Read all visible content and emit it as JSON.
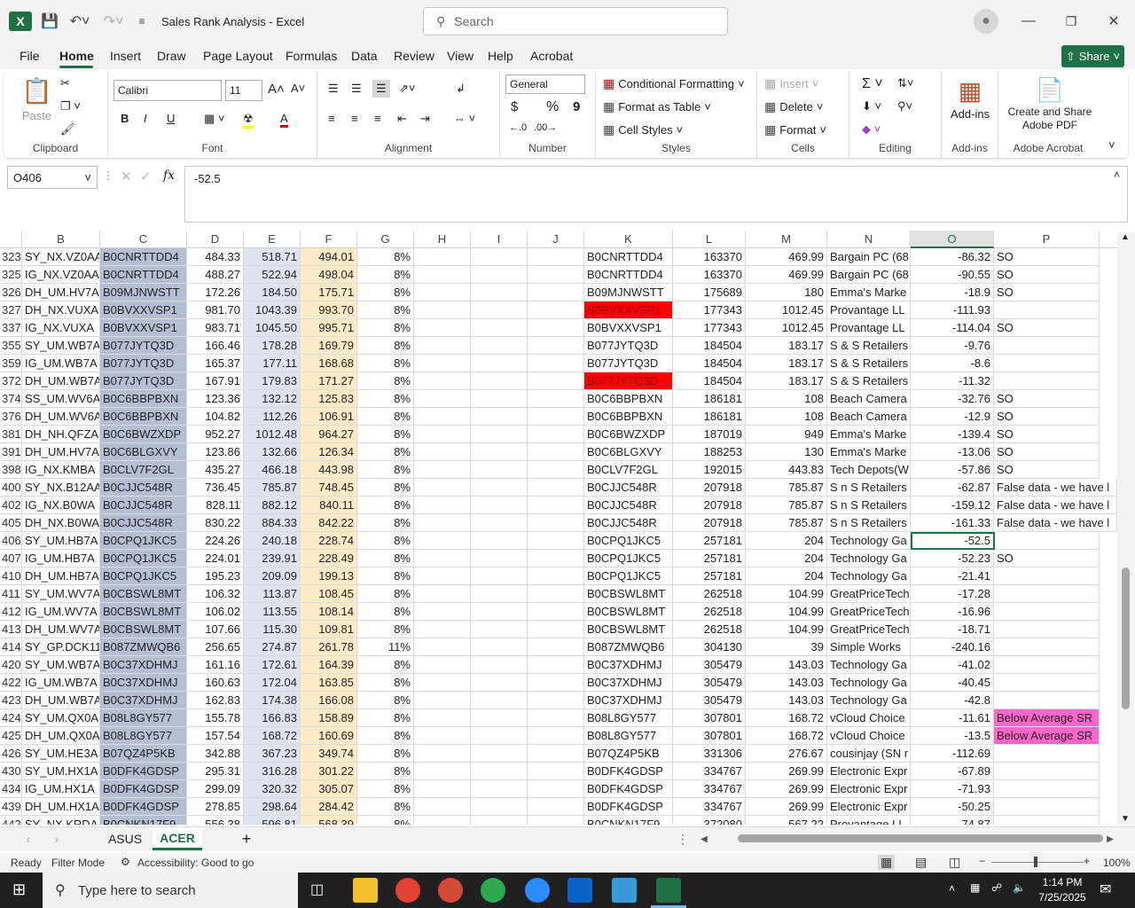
{
  "window": {
    "title": "Sales Rank Analysis  -  Excel",
    "search_placeholder": "Search",
    "share_label": "Share"
  },
  "menu": [
    "File",
    "Home",
    "Insert",
    "Draw",
    "Page Layout",
    "Formulas",
    "Data",
    "Review",
    "View",
    "Help",
    "Acrobat"
  ],
  "ribbon": {
    "clipboard": {
      "paste": "Paste",
      "label": "Clipboard"
    },
    "font": {
      "name": "Calibri",
      "size": "11",
      "label": "Font",
      "bold": "B",
      "italic": "I",
      "underline": "U"
    },
    "alignment": {
      "label": "Alignment"
    },
    "number": {
      "format": "General",
      "label": "Number",
      "dollar": "$",
      "percent": "%",
      "comma": "9"
    },
    "styles": {
      "cond": "Conditional Formatting",
      "table": "Format as Table",
      "cell": "Cell Styles",
      "label": "Styles"
    },
    "cells": {
      "insert": "Insert",
      "delete": "Delete",
      "format": "Format",
      "label": "Cells"
    },
    "editing": {
      "label": "Editing"
    },
    "addins": {
      "btn": "Add-ins",
      "label": "Add-ins"
    },
    "acrobat": {
      "btn": "Create and Share Adobe PDF",
      "label": "Adobe Acrobat"
    }
  },
  "formula": {
    "cell": "O406",
    "value": "-52.5",
    "fx": "fx"
  },
  "columns": [
    "B",
    "C",
    "D",
    "E",
    "F",
    "G",
    "H",
    "I",
    "J",
    "K",
    "L",
    "M",
    "N",
    "O",
    "P"
  ],
  "rows": [
    [
      "323",
      "SY_NX.VZ0AA",
      "B0CNRTTDD4",
      "484.33",
      "518.71",
      "494.01",
      "8%",
      "B0CNRTTDD4",
      "163370",
      "469.99",
      "Bargain PC (68",
      "-86.32",
      "SO"
    ],
    [
      "325",
      "IG_NX.VZ0AA",
      "B0CNRTTDD4",
      "488.27",
      "522.94",
      "498.04",
      "8%",
      "B0CNRTTDD4",
      "163370",
      "469.99",
      "Bargain PC (68",
      "-90.55",
      "SO"
    ],
    [
      "326",
      "DH_UM.HV7A",
      "B09MJNWSTT",
      "172.26",
      "184.50",
      "175.71",
      "8%",
      "B09MJNWSTT",
      "175689",
      "180",
      "Emma's Marke",
      "-18.9",
      "SO"
    ],
    [
      "327",
      "DH_NX.VUXA",
      "B0BVXXVSP1",
      "981.70",
      "1043.39",
      "993.70",
      "8%",
      "B0BVXXVSP1",
      "177343",
      "1012.45",
      "Provantage LL",
      "-111.93",
      ""
    ],
    [
      "337",
      "IG_NX.VUXA",
      "B0BVXXVSP1",
      "983.71",
      "1045.50",
      "995.71",
      "8%",
      "B0BVXXVSP1",
      "177343",
      "1012.45",
      "Provantage LL",
      "-114.04",
      "SO"
    ],
    [
      "355",
      "SY_UM.WB7A",
      "B077JYTQ3D",
      "166.46",
      "178.28",
      "169.79",
      "8%",
      "B077JYTQ3D",
      "184504",
      "183.17",
      "S & S Retailers",
      "-9.76",
      ""
    ],
    [
      "359",
      "IG_UM.WB7A",
      "B077JYTQ3D",
      "165.37",
      "177.11",
      "168.68",
      "8%",
      "B077JYTQ3D",
      "184504",
      "183.17",
      "S & S Retailers",
      "-8.6",
      ""
    ],
    [
      "372",
      "DH_UM.WB7A",
      "B077JYTQ3D",
      "167.91",
      "179.83",
      "171.27",
      "8%",
      "B077JYTQ3D",
      "184504",
      "183.17",
      "S & S Retailers",
      "-11.32",
      ""
    ],
    [
      "374",
      "SS_UM.WV6A",
      "B0C6BBPBXN",
      "123.36",
      "132.12",
      "125.83",
      "8%",
      "B0C6BBPBXN",
      "186181",
      "108",
      "Beach Camera",
      "-32.76",
      "SO"
    ],
    [
      "376",
      "DH_UM.WV6A",
      "B0C6BBPBXN",
      "104.82",
      "112.26",
      "106.91",
      "8%",
      "B0C6BBPBXN",
      "186181",
      "108",
      "Beach Camera",
      "-12.9",
      "SO"
    ],
    [
      "381",
      "DH_NH.QFZA",
      "B0C6BWZXDP",
      "952.27",
      "1012.48",
      "964.27",
      "8%",
      "B0C6BWZXDP",
      "187019",
      "949",
      "Emma's Marke",
      "-139.4",
      "SO"
    ],
    [
      "391",
      "DH_UM.HV7A",
      "B0C6BLGXVY",
      "123.86",
      "132.66",
      "126.34",
      "8%",
      "B0C6BLGXVY",
      "188253",
      "130",
      "Emma's Marke",
      "-13.06",
      "SO"
    ],
    [
      "398",
      "IG_NX.KMBA",
      "B0CLV7F2GL",
      "435.27",
      "466.18",
      "443.98",
      "8%",
      "B0CLV7F2GL",
      "192015",
      "443.83",
      "Tech Depots(W",
      "-57.86",
      "SO"
    ],
    [
      "400",
      "SY_NX.B12AA",
      "B0CJJC548R",
      "736.45",
      "785.87",
      "748.45",
      "8%",
      "B0CJJC548R",
      "207918",
      "785.87",
      "S n S Retailers",
      "-62.87",
      "False data - we have l"
    ],
    [
      "402",
      "IG_NX.B0WA",
      "B0CJJC548R",
      "828.11",
      "882.12",
      "840.11",
      "8%",
      "B0CJJC548R",
      "207918",
      "785.87",
      "S n S Retailers",
      "-159.12",
      "False data - we have l"
    ],
    [
      "405",
      "DH_NX.B0WA",
      "B0CJJC548R",
      "830.22",
      "884.33",
      "842.22",
      "8%",
      "B0CJJC548R",
      "207918",
      "785.87",
      "S n S Retailers",
      "-161.33",
      "False data - we have l"
    ],
    [
      "406",
      "SY_UM.HB7A",
      "B0CPQ1JKC5",
      "224.26",
      "240.18",
      "228.74",
      "8%",
      "B0CPQ1JKC5",
      "257181",
      "204",
      "Technology Ga",
      "-52.5",
      ""
    ],
    [
      "407",
      "IG_UM.HB7A",
      "B0CPQ1JKC5",
      "224.01",
      "239.91",
      "228.49",
      "8%",
      "B0CPQ1JKC5",
      "257181",
      "204",
      "Technology Ga",
      "-52.23",
      "SO"
    ],
    [
      "410",
      "DH_UM.HB7A",
      "B0CPQ1JKC5",
      "195.23",
      "209.09",
      "199.13",
      "8%",
      "B0CPQ1JKC5",
      "257181",
      "204",
      "Technology Ga",
      "-21.41",
      ""
    ],
    [
      "411",
      "SY_UM.WV7A",
      "B0CBSWL8MT",
      "106.32",
      "113.87",
      "108.45",
      "8%",
      "B0CBSWL8MT",
      "262518",
      "104.99",
      "GreatPriceTech",
      "-17.28",
      ""
    ],
    [
      "412",
      "IG_UM.WV7A",
      "B0CBSWL8MT",
      "106.02",
      "113.55",
      "108.14",
      "8%",
      "B0CBSWL8MT",
      "262518",
      "104.99",
      "GreatPriceTech",
      "-16.96",
      ""
    ],
    [
      "413",
      "DH_UM.WV7A",
      "B0CBSWL8MT",
      "107.66",
      "115.30",
      "109.81",
      "8%",
      "B0CBSWL8MT",
      "262518",
      "104.99",
      "GreatPriceTech",
      "-18.71",
      ""
    ],
    [
      "414",
      "SY_GP.DCK11",
      "B087ZMWQB6",
      "256.65",
      "274.87",
      "261.78",
      "11%",
      "B087ZMWQB6",
      "304130",
      "39",
      "Simple Works",
      "-240.16",
      ""
    ],
    [
      "420",
      "SY_UM.WB7A",
      "B0C37XDHMJ",
      "161.16",
      "172.61",
      "164.39",
      "8%",
      "B0C37XDHMJ",
      "305479",
      "143.03",
      "Technology Ga",
      "-41.02",
      ""
    ],
    [
      "422",
      "IG_UM.WB7A",
      "B0C37XDHMJ",
      "160.63",
      "172.04",
      "163.85",
      "8%",
      "B0C37XDHMJ",
      "305479",
      "143.03",
      "Technology Ga",
      "-40.45",
      ""
    ],
    [
      "423",
      "DH_UM.WB7A",
      "B0C37XDHMJ",
      "162.83",
      "174.38",
      "166.08",
      "8%",
      "B0C37XDHMJ",
      "305479",
      "143.03",
      "Technology Ga",
      "-42.8",
      ""
    ],
    [
      "424",
      "SY_UM.QX0A",
      "B08L8GY577",
      "155.78",
      "166.83",
      "158.89",
      "8%",
      "B08L8GY577",
      "307801",
      "168.72",
      "vCloud Choice",
      "-11.61",
      "Below Average SR"
    ],
    [
      "425",
      "DH_UM.QX0A",
      "B08L8GY577",
      "157.54",
      "168.72",
      "160.69",
      "8%",
      "B08L8GY577",
      "307801",
      "168.72",
      "vCloud Choice",
      "-13.5",
      "Below Average SR"
    ],
    [
      "426",
      "SY_UM.HE3A",
      "B07QZ4P5KB",
      "342.88",
      "367.23",
      "349.74",
      "8%",
      "B07QZ4P5KB",
      "331306",
      "276.67",
      "cousinjay (SN r",
      "-112.69",
      ""
    ],
    [
      "430",
      "SY_UM.HX1A",
      "B0DFK4GDSP",
      "295.31",
      "316.28",
      "301.22",
      "8%",
      "B0DFK4GDSP",
      "334767",
      "269.99",
      "Electronic Expr",
      "-67.89",
      ""
    ],
    [
      "434",
      "IG_UM.HX1A",
      "B0DFK4GDSP",
      "299.09",
      "320.32",
      "305.07",
      "8%",
      "B0DFK4GDSP",
      "334767",
      "269.99",
      "Electronic Expr",
      "-71.93",
      ""
    ],
    [
      "439",
      "DH_UM.HX1A",
      "B0DFK4GDSP",
      "278.85",
      "298.64",
      "284.42",
      "8%",
      "B0DFK4GDSP",
      "334767",
      "269.99",
      "Electronic Expr",
      "-50.25",
      ""
    ],
    [
      "442",
      "SY_NX.KRDA",
      "B0CNKN17F9",
      "556.38",
      "596.81",
      "568.39",
      "8%",
      "B0CNKN17F9",
      "372080",
      "567.22",
      "Provantage LL",
      "-74.87",
      ""
    ]
  ],
  "red_rows": [
    3,
    7
  ],
  "pink_rows": [
    26,
    27
  ],
  "sheets": [
    "ASUS",
    "ACER"
  ],
  "active_sheet": "ACER",
  "status": {
    "ready": "Ready",
    "filter": "Filter Mode",
    "accessibility": "Accessibility: Good to go",
    "zoom": "100%"
  },
  "taskbar": {
    "search": "Type here to search",
    "time": "1:14 PM",
    "date": "7/25/2025"
  }
}
